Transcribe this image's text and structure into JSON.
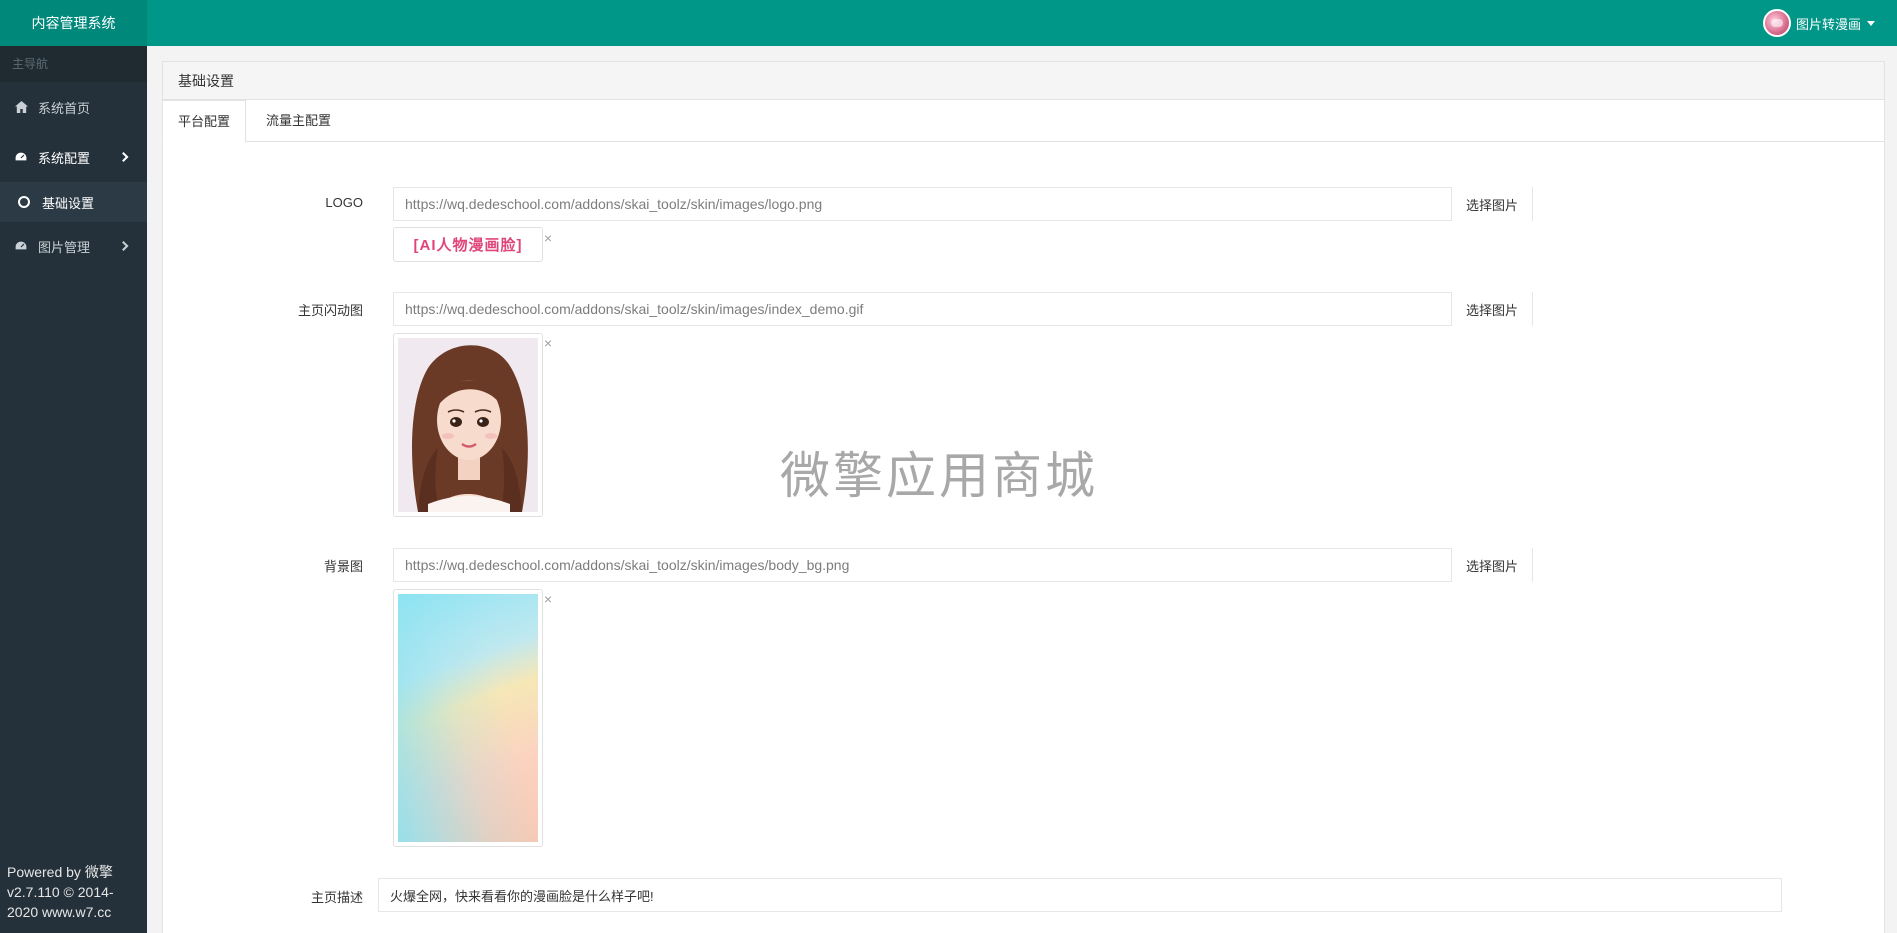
{
  "app": {
    "title": "内容管理系统"
  },
  "user": {
    "name": "图片转漫画"
  },
  "sidebar": {
    "heading": "主导航",
    "items": [
      {
        "label": "系统首页",
        "icon": "home-icon"
      },
      {
        "label": "系统配置",
        "icon": "dashboard-icon"
      },
      {
        "label": "基础设置",
        "icon": "circle-icon"
      },
      {
        "label": "图片管理",
        "icon": "dashboard-icon"
      }
    ],
    "footer": {
      "line1": "Powered by 微擎",
      "line2": "v2.7.110 © 2014-",
      "line3": "2020 www.w7.cc"
    }
  },
  "panel": {
    "title": "基础设置",
    "tabs": [
      {
        "label": "平台配置"
      },
      {
        "label": "流量主配置"
      }
    ]
  },
  "form": {
    "logo": {
      "label": "LOGO",
      "value": "https://wq.dedeschool.com/addons/skai_toolz/skin/images/logo.png",
      "button": "选择图片",
      "preview_text": "[AI人物漫画脸]"
    },
    "splash": {
      "label": "主页闪动图",
      "value": "https://wq.dedeschool.com/addons/skai_toolz/skin/images/index_demo.gif",
      "button": "选择图片"
    },
    "background": {
      "label": "背景图",
      "value": "https://wq.dedeschool.com/addons/skai_toolz/skin/images/body_bg.png",
      "button": "选择图片"
    },
    "description": {
      "label": "主页描述",
      "value": "火爆全网，快来看看你的漫画脸是什么样子吧!"
    },
    "remove_symbol": "×"
  },
  "watermark": "微擎应用商城",
  "colors": {
    "topbar": "#009688",
    "sidebar": "#24313a"
  }
}
